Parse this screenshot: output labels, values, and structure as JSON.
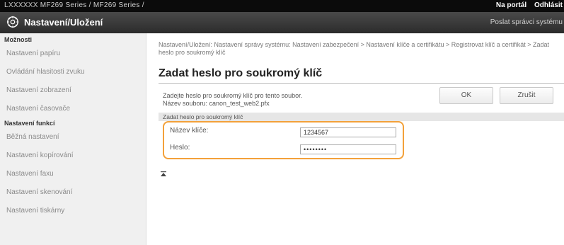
{
  "topbar": {
    "model": "LXXXXXX  MF269 Series / MF269 Series /",
    "portal_label": "Na portál",
    "logout_label": "Odhlásit"
  },
  "header": {
    "title": "Nastavení/Uložení",
    "send_label": "Poslat správci systému"
  },
  "sidebar": {
    "group1": "Možnosti",
    "items1": [
      "Nastavení papíru",
      "Ovládání hlasitosti zvuku",
      "Nastavení zobrazení",
      "Nastavení časovače"
    ],
    "group2": "Nastavení funkcí",
    "items2": [
      "Běžná nastavení",
      "Nastavení kopírování",
      "Nastavení faxu",
      "Nastavení skenování",
      "Nastavení tiskárny"
    ]
  },
  "main": {
    "breadcrumb": "Nastavení/Uložení: Nastavení správy systému: Nastavení zabezpečení > Nastavení klíče a certifikátu > Registrovat klíč a certifikát > Zadat heslo pro soukromý klíč",
    "title": "Zadat heslo pro soukromý klíč",
    "desc_line1": "Zadejte heslo pro soukromý klíč pro tento soubor.",
    "desc_line2": "Název souboru: canon_test_web2.pfx",
    "ok_label": "OK",
    "cancel_label": "Zrušit",
    "section_title": "Zadat heslo pro soukromý klíč",
    "key_name_label": "Název klíče:",
    "key_name_value": "1234567",
    "password_label": "Heslo:",
    "password_value": "••••••••"
  },
  "colors": {
    "highlight": "#f3a13a",
    "header_bg": "#2b2b2b"
  }
}
